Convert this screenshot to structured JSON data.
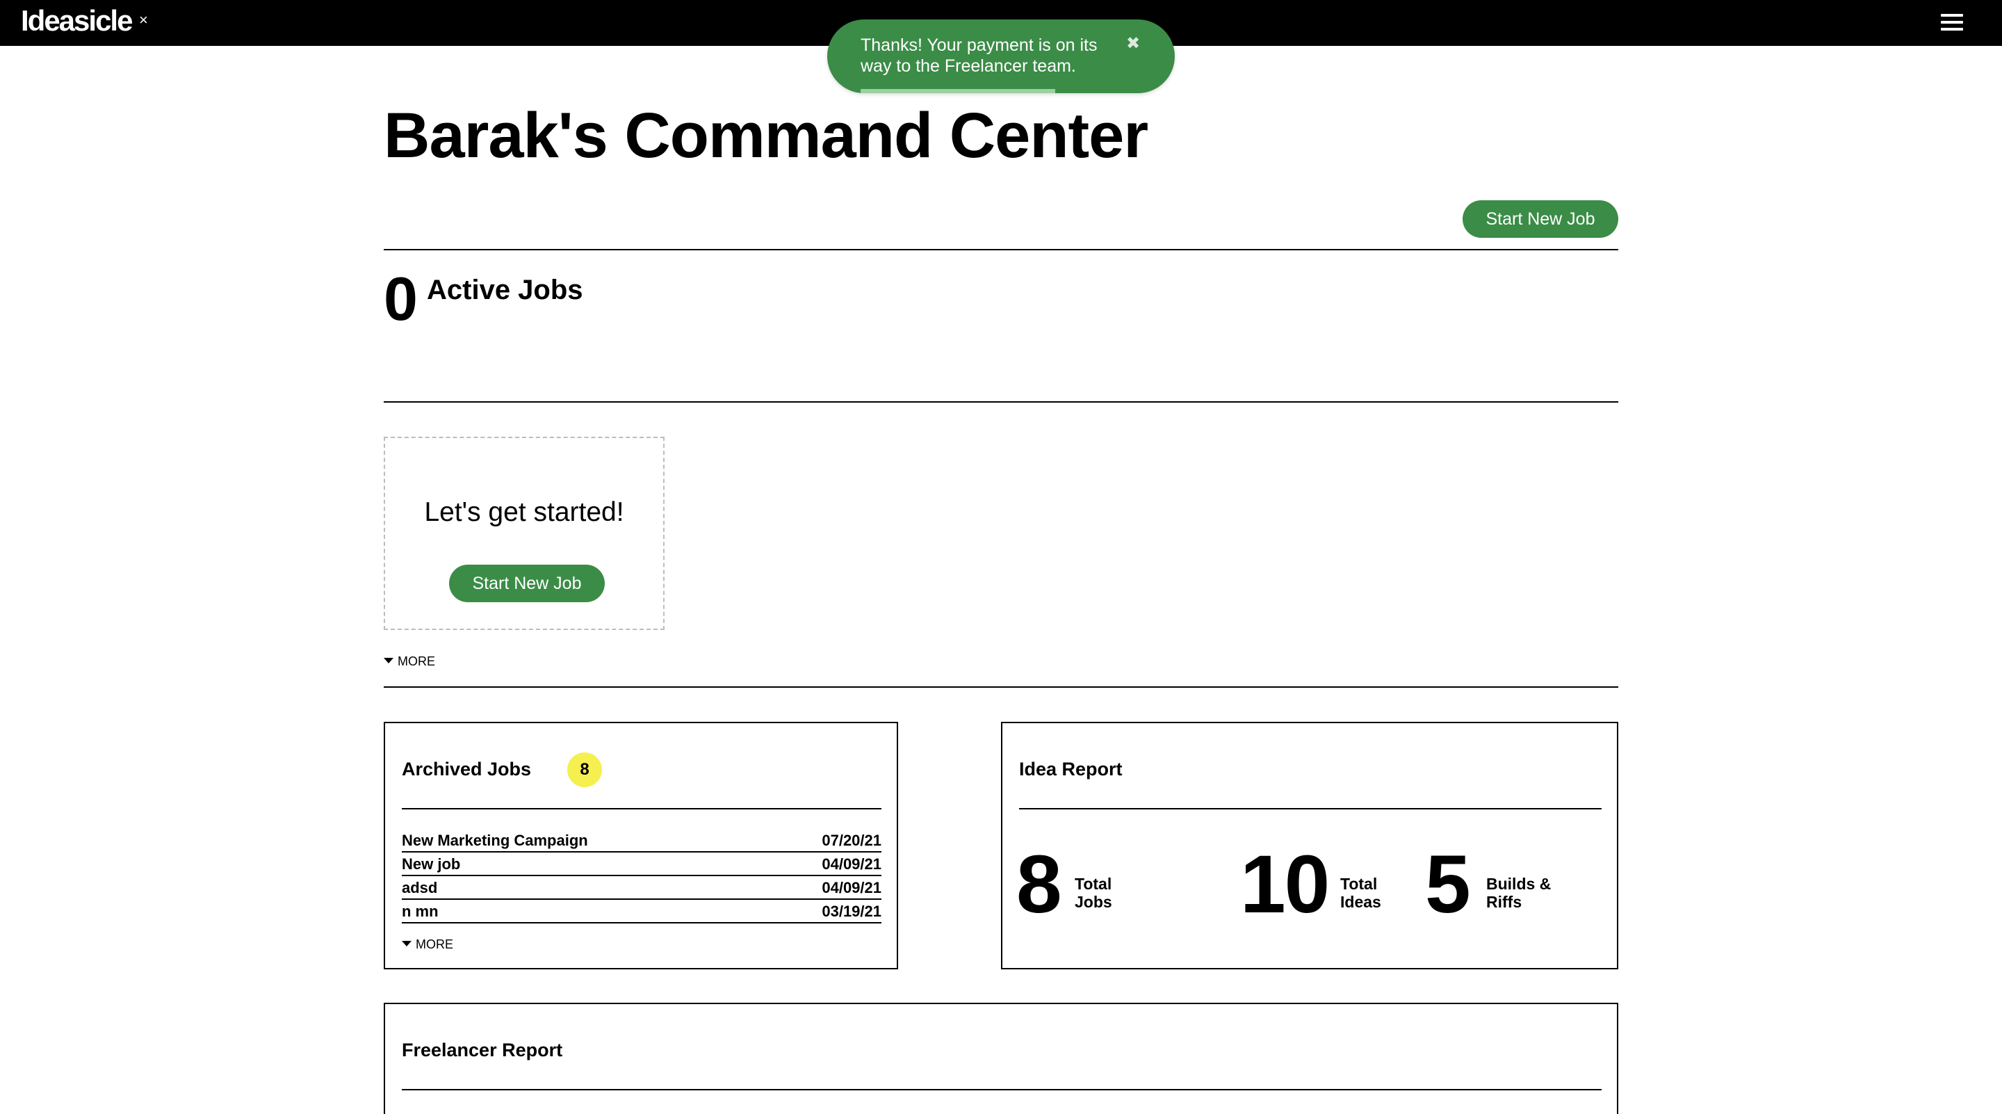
{
  "app": {
    "name": "Ideasicle",
    "close_glyph": "×"
  },
  "toast": {
    "message": "Thanks! Your payment is on its way to the Freelancer team.",
    "close_glyph": "✖"
  },
  "page": {
    "title": "Barak's Command Center"
  },
  "header_actions": {
    "start_new_job": "Start New Job"
  },
  "active_jobs": {
    "count": "0",
    "label": "Active Jobs"
  },
  "get_started": {
    "title": "Let's get started!",
    "button": "Start New Job"
  },
  "more_label": "MORE",
  "archived_jobs": {
    "title": "Archived Jobs",
    "count": "8",
    "rows": [
      {
        "name": "New Marketing Campaign",
        "date": "07/20/21"
      },
      {
        "name": "New job",
        "date": "04/09/21"
      },
      {
        "name": "adsd",
        "date": "04/09/21"
      },
      {
        "name": "n mn",
        "date": "03/19/21"
      }
    ],
    "more": "MORE"
  },
  "idea_report": {
    "title": "Idea Report",
    "stats": [
      {
        "value": "8",
        "label_line1": "Total",
        "label_line2": "Jobs"
      },
      {
        "value": "10",
        "label_line1": "Total",
        "label_line2": "Ideas"
      },
      {
        "value": "5",
        "label_line1": "Builds &",
        "label_line2": "Riffs"
      }
    ]
  },
  "freelancer_report": {
    "title": "Freelancer Report"
  },
  "colors": {
    "accent_green": "#3b8c47",
    "badge_yellow": "#f5ef50",
    "topbar": "#000000"
  }
}
